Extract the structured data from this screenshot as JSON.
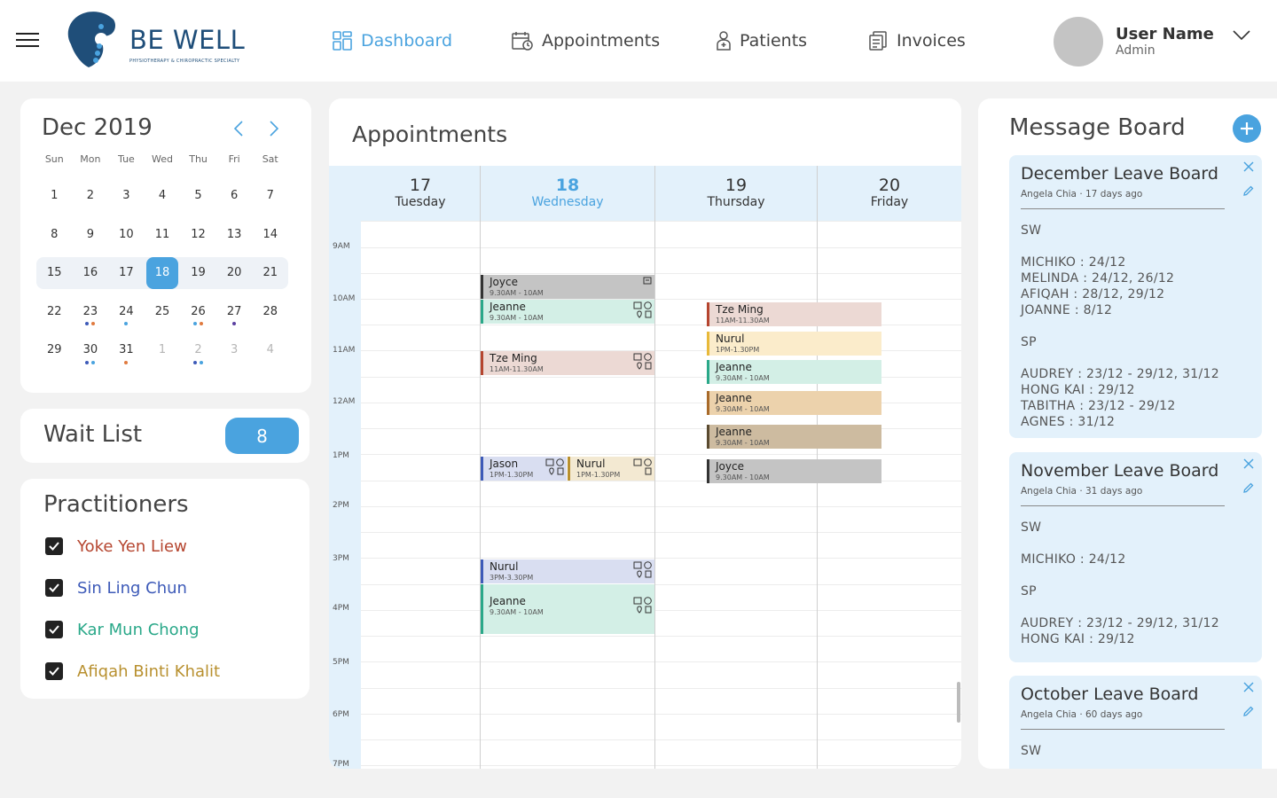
{
  "header": {
    "brand": "BE WELL",
    "brand_sub": "PHYSIOTHERAPY & CHIROPRACTIC SPECIALTY",
    "nav": [
      {
        "label": "Dashboard",
        "icon": "dashboard-icon",
        "active": true
      },
      {
        "label": "Appointments",
        "icon": "calendar-icon",
        "active": false
      },
      {
        "label": "Patients",
        "icon": "patient-icon",
        "active": false
      },
      {
        "label": "Invoices",
        "icon": "invoice-icon",
        "active": false
      }
    ],
    "user": {
      "name": "User Name",
      "role": "Admin"
    }
  },
  "calendar": {
    "title": "Dec 2019",
    "weekdays": [
      "Sun",
      "Mon",
      "Tue",
      "Wed",
      "Thu",
      "Fri",
      "Sat"
    ],
    "weeks": [
      [
        "1",
        "2",
        "3",
        "4",
        "5",
        "6",
        "7"
      ],
      [
        "8",
        "9",
        "10",
        "11",
        "12",
        "13",
        "14"
      ],
      [
        "15",
        "16",
        "17",
        "18",
        "19",
        "20",
        "21"
      ],
      [
        "22",
        "23",
        "24",
        "25",
        "26",
        "27",
        "28"
      ],
      [
        "29",
        "30",
        "31",
        "1",
        "2",
        "3",
        "4"
      ]
    ],
    "selected": "18"
  },
  "waitlist": {
    "label": "Wait List",
    "count": "8"
  },
  "practitioners": {
    "title": "Practitioners",
    "items": [
      {
        "name": "Yoke Yen Liew",
        "color": "#b5452f",
        "checked": true
      },
      {
        "name": "Sin Ling Chun",
        "color": "#3d5ab8",
        "checked": true
      },
      {
        "name": "Kar Mun Chong",
        "color": "#2aa889",
        "checked": true
      },
      {
        "name": "Afiqah Binti Khalit",
        "color": "#b8902f",
        "checked": true
      }
    ]
  },
  "appointments": {
    "title": "Appointments",
    "days": [
      {
        "num": "17",
        "name": "Tuesday",
        "today": false
      },
      {
        "num": "18",
        "name": "Wednesday",
        "today": true
      },
      {
        "num": "19",
        "name": "Thursday",
        "today": false
      },
      {
        "num": "20",
        "name": "Friday",
        "today": false
      }
    ],
    "times": [
      "9AM",
      "10AM",
      "11AM",
      "12AM",
      "1PM",
      "2PM",
      "3PM",
      "4PM",
      "5PM",
      "6PM",
      "7PM"
    ],
    "events": [
      {
        "name": "Joyce",
        "time": "9.30AM - 10AM"
      },
      {
        "name": "Jeanne",
        "time": "9.30AM - 10AM"
      },
      {
        "name": "Tze Ming",
        "time": "11AM-11.30AM"
      },
      {
        "name": "Jason",
        "time": "1PM-1.30PM"
      },
      {
        "name": "Nurul",
        "time": "1PM-1.30PM"
      },
      {
        "name": "Nurul",
        "time": "3PM-3.30PM"
      },
      {
        "name": "Jeanne",
        "time": "9.30AM - 10AM"
      },
      {
        "name": "Tze Ming",
        "time": "11AM-11.30AM"
      },
      {
        "name": "Nurul",
        "time": "1PM-1.30PM"
      },
      {
        "name": "Jeanne",
        "time": "9.30AM - 10AM"
      },
      {
        "name": "Jeanne",
        "time": "9.30AM - 10AM"
      },
      {
        "name": "Jeanne",
        "time": "9.30AM - 10AM"
      },
      {
        "name": "Joyce",
        "time": "9.30AM - 10AM"
      }
    ]
  },
  "message_board": {
    "title": "Message Board",
    "messages": [
      {
        "title": "December Leave Board",
        "meta": "Angela Chia · 17 days ago",
        "lines": [
          "SW",
          "",
          "MICHIKO : 24/12",
          "MELINDA : 24/12, 26/12",
          "AFIQAH : 28/12, 29/12",
          "JOANNE : 8/12",
          "",
          "SP",
          "",
          "AUDREY : 23/12 - 29/12, 31/12",
          "HONG KAI : 29/12",
          "TABITHA : 23/12 - 29/12",
          "AGNES : 31/12"
        ]
      },
      {
        "title": "November Leave Board",
        "meta": "Angela Chia · 31 days ago",
        "lines": [
          "SW",
          "",
          "MICHIKO : 24/12",
          "",
          "SP",
          "",
          "AUDREY : 23/12 - 29/12, 31/12",
          "HONG KAI : 29/12"
        ]
      },
      {
        "title": "October Leave Board",
        "meta": "Angela Chia · 60 days ago",
        "lines": [
          "SW"
        ]
      }
    ]
  }
}
